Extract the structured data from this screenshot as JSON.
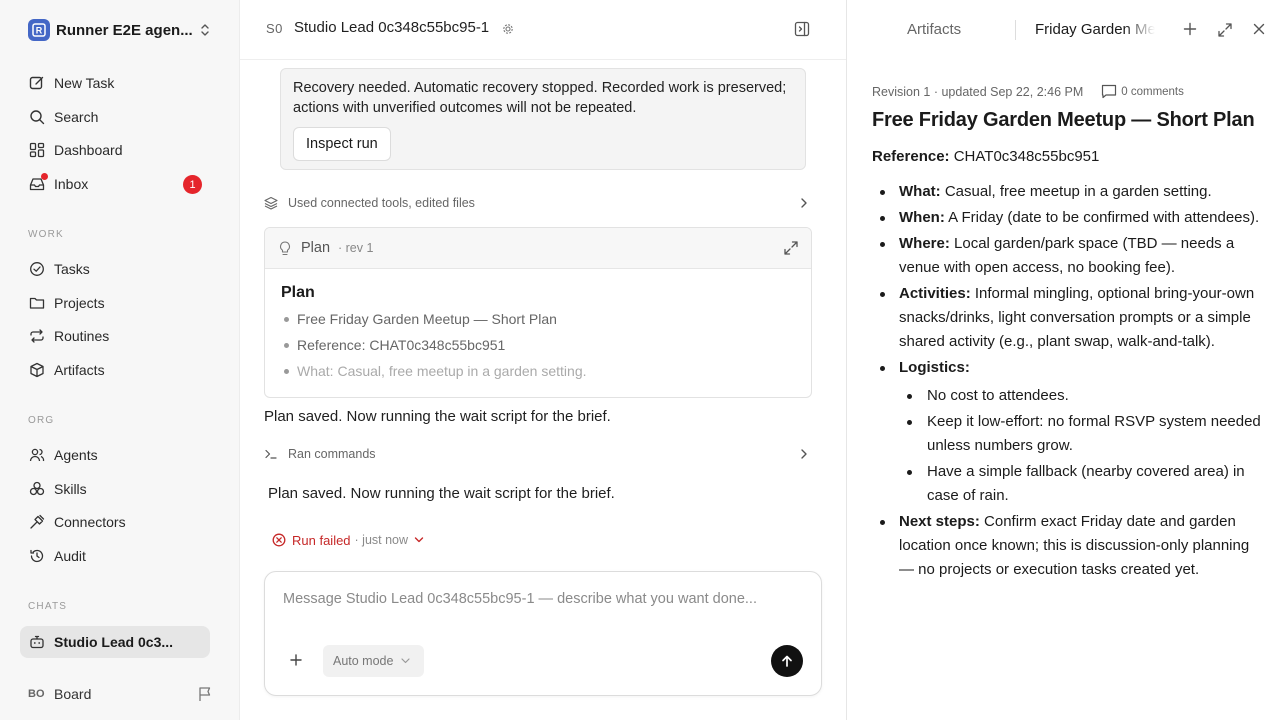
{
  "workspace": {
    "name": "Runner E2E agen...",
    "logo_letter": "R"
  },
  "sidebar": {
    "nav": [
      {
        "label": "New Task",
        "icon": "edit-icon"
      },
      {
        "label": "Search",
        "icon": "search-icon"
      },
      {
        "label": "Dashboard",
        "icon": "dashboard-icon"
      },
      {
        "label": "Inbox",
        "icon": "inbox-icon",
        "badge": "1"
      }
    ],
    "work_heading": "WORK",
    "work": [
      {
        "label": "Tasks",
        "icon": "check-circle-icon"
      },
      {
        "label": "Projects",
        "icon": "folder-icon"
      },
      {
        "label": "Routines",
        "icon": "repeat-icon"
      },
      {
        "label": "Artifacts",
        "icon": "cube-icon"
      }
    ],
    "org_heading": "ORG",
    "org": [
      {
        "label": "Agents",
        "icon": "users-icon"
      },
      {
        "label": "Skills",
        "icon": "boxes-icon"
      },
      {
        "label": "Connectors",
        "icon": "plug-icon"
      },
      {
        "label": "Audit",
        "icon": "history-icon"
      }
    ],
    "chats_heading": "CHATS",
    "chats": [
      {
        "label": "Studio Lead 0c3...",
        "icon": "bot-icon"
      }
    ],
    "footer": {
      "initials": "BO",
      "label": "Board"
    }
  },
  "main": {
    "header": {
      "initials": "S0",
      "title": "Studio Lead 0c348c55bc95-1"
    },
    "alert": {
      "text": "Recovery needed. Automatic recovery stopped. Recorded work is preserved; actions with unverified outcomes will not be repeated.",
      "button": "Inspect run"
    },
    "tools_row": "Used connected tools, edited files",
    "plan_card": {
      "label": "Plan",
      "rev": "· rev 1",
      "heading": "Plan",
      "items": [
        "Free Friday Garden Meetup — Short Plan",
        "Reference: CHAT0c348c55bc951",
        "What: Casual, free meetup in a garden setting."
      ]
    },
    "message_1": "Plan saved. Now running the wait script for the brief.",
    "commands_row": "Ran commands",
    "message_2": "Plan saved. Now running the wait script for the brief.",
    "status": {
      "label": "Run failed",
      "time": "· just now"
    },
    "composer": {
      "placeholder": "Message Studio Lead 0c348c55bc95-1 — describe what you want done...",
      "mode": "Auto mode"
    }
  },
  "panel": {
    "tabs": {
      "artifacts": "Artifacts",
      "current": "Friday Garden Meetup"
    },
    "meta": {
      "revision": "Revision 1 · updated Sep 22, 2:46 PM",
      "comments": "0 comments"
    },
    "title": "Free Friday Garden Meetup — Short Plan",
    "reference": {
      "label": "Reference:",
      "value": "CHAT0c348c55bc951"
    },
    "items": [
      {
        "label": "What:",
        "text": "Casual, free meetup in a garden setting."
      },
      {
        "label": "When:",
        "text": "A Friday (date to be confirmed with attendees)."
      },
      {
        "label": "Where:",
        "text": "Local garden/park space (TBD — needs a venue with open access, no booking fee)."
      },
      {
        "label": "Activities:",
        "text": "Informal mingling, optional bring-your-own snacks/drinks, light conversation prompts or a simple shared activity (e.g., plant swap, walk-and-talk)."
      },
      {
        "label": "Logistics:",
        "text": ""
      },
      {
        "label": "Next steps:",
        "text": "Confirm exact Friday date and garden location once known; this is discussion-only planning — no projects or execution tasks created yet."
      }
    ],
    "logistics": [
      "No cost to attendees.",
      "Keep it low-effort: no formal RSVP system needed unless numbers grow.",
      "Have a simple fallback (nearby covered area) in case of rain."
    ]
  }
}
